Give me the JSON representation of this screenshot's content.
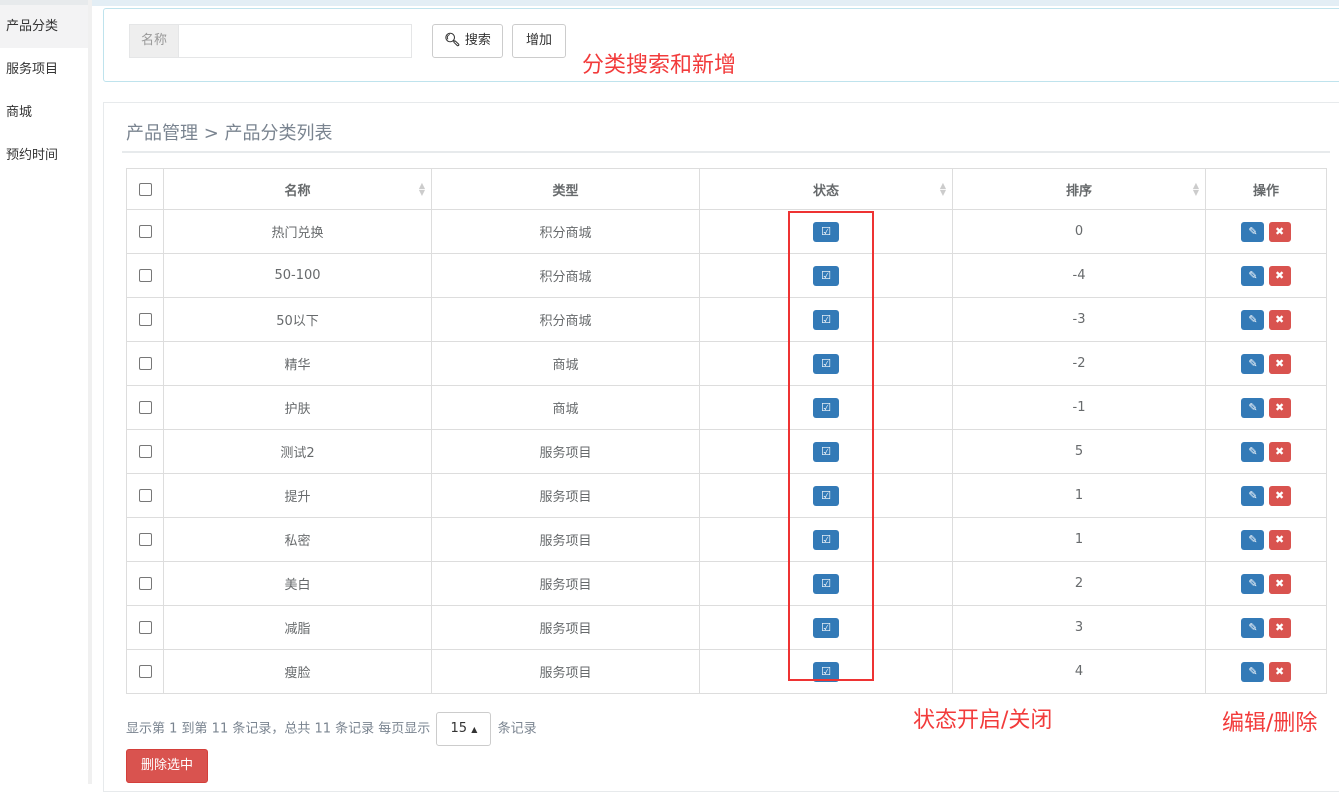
{
  "sidebar": {
    "items": [
      "产品分类",
      "服务项目",
      "商城",
      "预约时间"
    ]
  },
  "search": {
    "addon": "名称",
    "value": "",
    "search_label": "搜索",
    "add_label": "增加"
  },
  "breadcrumb": "产品管理 > 产品分类列表",
  "table": {
    "headers": [
      "名称",
      "类型",
      "状态",
      "排序",
      "操作"
    ],
    "rows": [
      {
        "name": "热门兑换",
        "type": "积分商城",
        "sort": "0"
      },
      {
        "name": "50-100",
        "type": "积分商城",
        "sort": "-4"
      },
      {
        "name": "50以下",
        "type": "积分商城",
        "sort": "-3"
      },
      {
        "name": "精华",
        "type": "商城",
        "sort": "-2"
      },
      {
        "name": "护肤",
        "type": "商城",
        "sort": "-1"
      },
      {
        "name": "测试2",
        "type": "服务项目",
        "sort": "5"
      },
      {
        "name": "提升",
        "type": "服务项目",
        "sort": "1"
      },
      {
        "name": "私密",
        "type": "服务项目",
        "sort": "1"
      },
      {
        "name": "美白",
        "type": "服务项目",
        "sort": "2"
      },
      {
        "name": "减脂",
        "type": "服务项目",
        "sort": "3"
      },
      {
        "name": "瘦脸",
        "type": "服务项目",
        "sort": "4"
      }
    ]
  },
  "pagination": {
    "info": "显示第 1 到第 11 条记录，总共 11 条记录 每页显示",
    "page_size": "15",
    "suffix": "条记录"
  },
  "delete_selected": "删除选中",
  "annotations": {
    "search": "分类搜索和新增",
    "status": "状态开启/关闭",
    "ops": "编辑/删除"
  }
}
